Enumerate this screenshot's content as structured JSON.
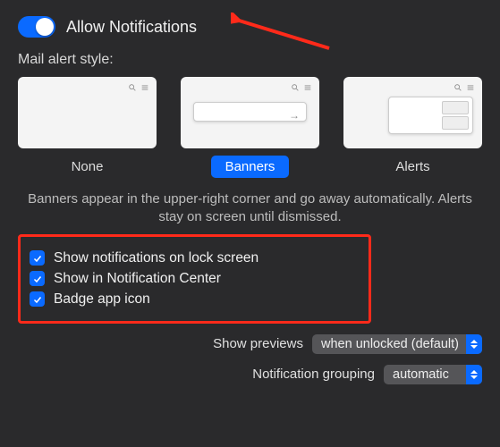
{
  "toggle": {
    "label": "Allow Notifications",
    "on": true
  },
  "alert_style_heading": "Mail alert style:",
  "styles": {
    "none": "None",
    "banners": "Banners",
    "alerts": "Alerts",
    "selected": "banners"
  },
  "description": "Banners appear in the upper-right corner and go away automatically. Alerts stay on screen until dismissed.",
  "checks": {
    "lock_screen": "Show notifications on lock screen",
    "notif_center": "Show in Notification Center",
    "badge": "Badge app icon"
  },
  "previews": {
    "label": "Show previews",
    "value": "when unlocked (default)"
  },
  "grouping": {
    "label": "Notification grouping",
    "value": "automatic"
  },
  "colors": {
    "accent": "#0a6aff",
    "highlight_box": "#ff2a1a",
    "bg": "#2a2a2c"
  }
}
